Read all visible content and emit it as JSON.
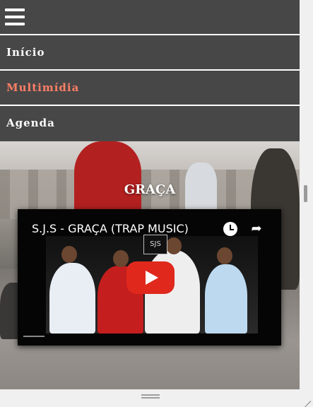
{
  "menu": {
    "items": [
      {
        "label": "Início"
      },
      {
        "label": "Multimídia"
      },
      {
        "label": "Agenda"
      }
    ],
    "active_color": "#ff7f66"
  },
  "hero": {
    "title": "GRAÇA"
  },
  "video": {
    "title": "S.J.S - GRAÇA (TRAP MUSIC)",
    "logo_text": "SJS",
    "icons": [
      "watch-later-icon",
      "share-icon",
      "play-icon"
    ],
    "play_color": "#e0281d"
  }
}
